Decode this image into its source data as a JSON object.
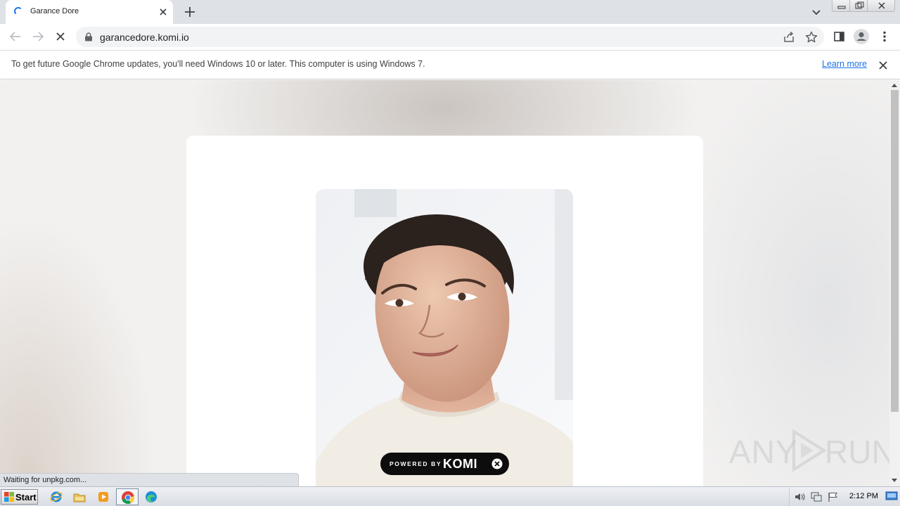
{
  "browser": {
    "tab": {
      "title": "Garance Dore"
    },
    "omnibox": {
      "url": "garancedore.komi.io"
    },
    "infobar": {
      "message": "To get future Google Chrome updates, you'll need Windows 10 or later. This computer is using Windows 7.",
      "learn_more": "Learn more"
    },
    "status_text": "Waiting for unpkg.com..."
  },
  "page": {
    "powered_label": "POWERED BY",
    "brand": "KOMI",
    "watermark": {
      "left": "ANY",
      "right": "RUN"
    }
  },
  "taskbar": {
    "start_label": "Start",
    "clock": "2:12 PM"
  },
  "colors": {
    "accent": "#1a73e8",
    "tabstrip": "#dee1e6",
    "pill": "#0d0d0d"
  },
  "icons": [
    "loading-spinner-icon",
    "close-icon",
    "plus-icon",
    "chevron-down-icon",
    "back-arrow-icon",
    "forward-arrow-icon",
    "stop-icon",
    "lock-icon",
    "share-icon",
    "star-icon",
    "side-panel-icon",
    "profile-icon",
    "menu-icon",
    "ie-icon",
    "folder-icon",
    "media-player-icon",
    "chrome-icon",
    "edge-icon",
    "speaker-icon",
    "network-icon",
    "flag-icon"
  ]
}
